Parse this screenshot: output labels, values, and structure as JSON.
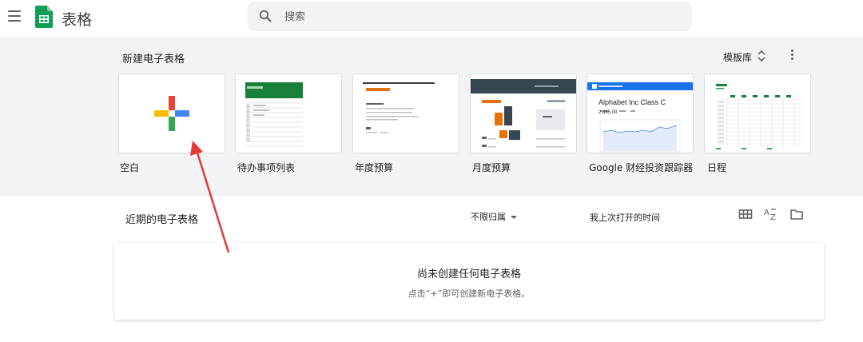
{
  "app": {
    "title": "表格"
  },
  "search": {
    "placeholder": "搜索"
  },
  "templates": {
    "section_title": "新建电子表格",
    "gallery_label": "模板库",
    "cards": [
      {
        "label": "空白"
      },
      {
        "label": "待办事项列表"
      },
      {
        "label": "年度预算"
      },
      {
        "label": "月度预算"
      },
      {
        "label": "Google 财经投资跟踪器"
      },
      {
        "label": "日程"
      }
    ],
    "finance_preview": {
      "title": "Alphabet Inc Class C",
      "price": "2,465.00"
    }
  },
  "recent": {
    "section_title": "近期的电子表格",
    "owner_filter": "不限归属",
    "sort_label": "我上次打开的时间",
    "empty_title": "尚未创建任何电子表格",
    "empty_subtitle": "点击“+”即可创建新电子表格。"
  },
  "colors": {
    "sheets_green": "#0f9d58",
    "annotation_red": "#e53935",
    "header_bg": "#f1f3f4"
  }
}
